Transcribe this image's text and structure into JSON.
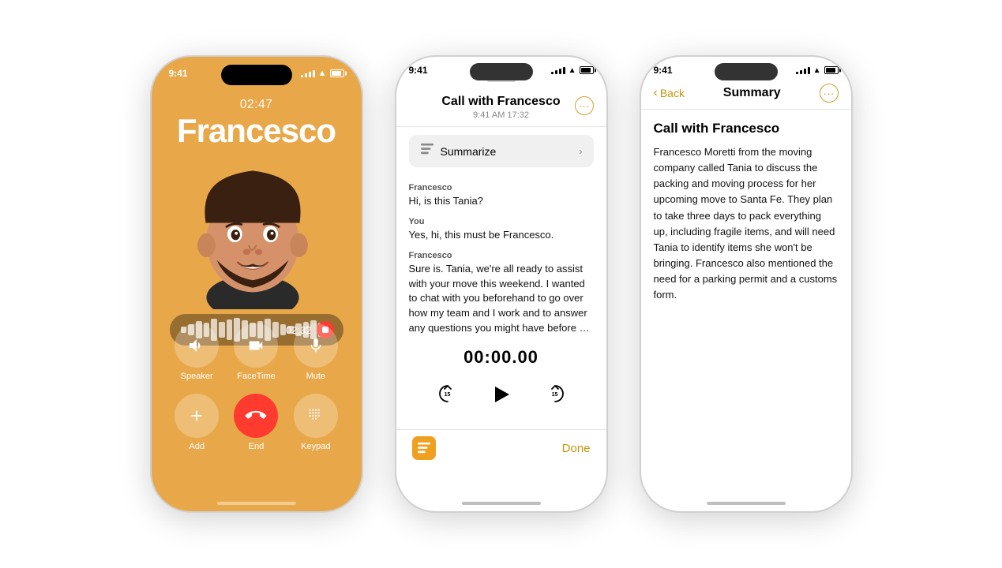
{
  "phone1": {
    "status_time": "9:41",
    "call_duration": "02:47",
    "caller_name": "Francesco",
    "rec_time": "02:32",
    "buttons_row1": [
      {
        "label": "Speaker",
        "icon": "🔊"
      },
      {
        "label": "FaceTime",
        "icon": "📷"
      },
      {
        "label": "Mute",
        "icon": "🎙"
      }
    ],
    "buttons_row2": [
      {
        "label": "Add",
        "icon": "👤"
      },
      {
        "label": "End",
        "icon": "📞",
        "type": "end"
      },
      {
        "label": "Keypad",
        "icon": "⌨️"
      }
    ]
  },
  "phone2": {
    "status_time": "9:41",
    "header_title": "Call with Francesco",
    "header_subtitle": "9:41 AM  17:32",
    "more_icon": "···",
    "summarize_label": "Summarize",
    "messages": [
      {
        "sender": "Francesco",
        "text": "Hi, is this Tania?"
      },
      {
        "sender": "You",
        "text": "Yes, hi, this must be Francesco."
      },
      {
        "sender": "Francesco",
        "text": "Sure is. Tania, we're all ready to assist with your move this weekend. I wanted to chat with you beforehand to go over how my team and I work and to answer any questions you might have before we arrive Saturday"
      }
    ],
    "audio_timestamp": "00:00.00",
    "skip_back_label": "15",
    "skip_fwd_label": "15",
    "done_label": "Done"
  },
  "phone3": {
    "status_time": "9:41",
    "back_label": "Back",
    "nav_title": "Summary",
    "more_icon": "···",
    "call_title": "Call with Francesco",
    "summary_text": "Francesco Moretti from the moving company called Tania to discuss the packing and moving process for her upcoming move to Santa Fe. They plan to take three days to pack everything up, including fragile items, and will need Tania to identify items she won't be bringing. Francesco also mentioned the need for a parking permit and a customs form."
  }
}
